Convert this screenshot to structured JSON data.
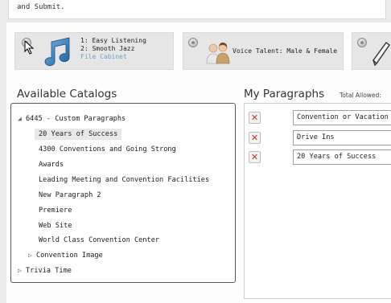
{
  "intro": {
    "text": "and Submit."
  },
  "tiles": [
    {
      "line1": "1: Easy Listening",
      "line2": "2: Smooth Jazz",
      "link": "File Cabinet",
      "icon": "music-note-icon"
    },
    {
      "label": "Voice Talent: Male & Female",
      "icon": "people-icon"
    },
    {
      "icon": "pen-icon"
    }
  ],
  "catalogs": {
    "title": "Available Catalogs",
    "items": [
      {
        "label": "6445 - Custom Paragraphs",
        "arrow": "◢",
        "level": 0
      },
      {
        "label": "20 Years of Success",
        "arrow": "",
        "level": 1,
        "selected": true
      },
      {
        "label": "4300 Conventions and Going Strong",
        "arrow": "",
        "level": 1
      },
      {
        "label": "Awards",
        "arrow": "",
        "level": 1
      },
      {
        "label": "Leading Meeting and Convention Facilities",
        "arrow": "",
        "level": 1
      },
      {
        "label": "New Paragraph 2",
        "arrow": "",
        "level": 1
      },
      {
        "label": "Premiere",
        "arrow": "",
        "level": 1
      },
      {
        "label": "Web Site",
        "arrow": "",
        "level": 1
      },
      {
        "label": "World Class Convention Center",
        "arrow": "",
        "level": 1
      },
      {
        "label": "Convention Image",
        "arrow": "▷",
        "level": 0.6
      },
      {
        "label": "Trivia Time",
        "arrow": "▷",
        "level": 0
      }
    ]
  },
  "paragraphs": {
    "title": "My Paragraphs",
    "total_label": "Total Allowed:",
    "items": [
      {
        "value": "Convention or Vacation Destination"
      },
      {
        "value": "Drive Ins"
      },
      {
        "value": "20 Years of Success"
      }
    ]
  },
  "colors": {
    "delete": "#c0392b",
    "link": "#6aa4c8",
    "tree_border": "#5a5a5a"
  }
}
